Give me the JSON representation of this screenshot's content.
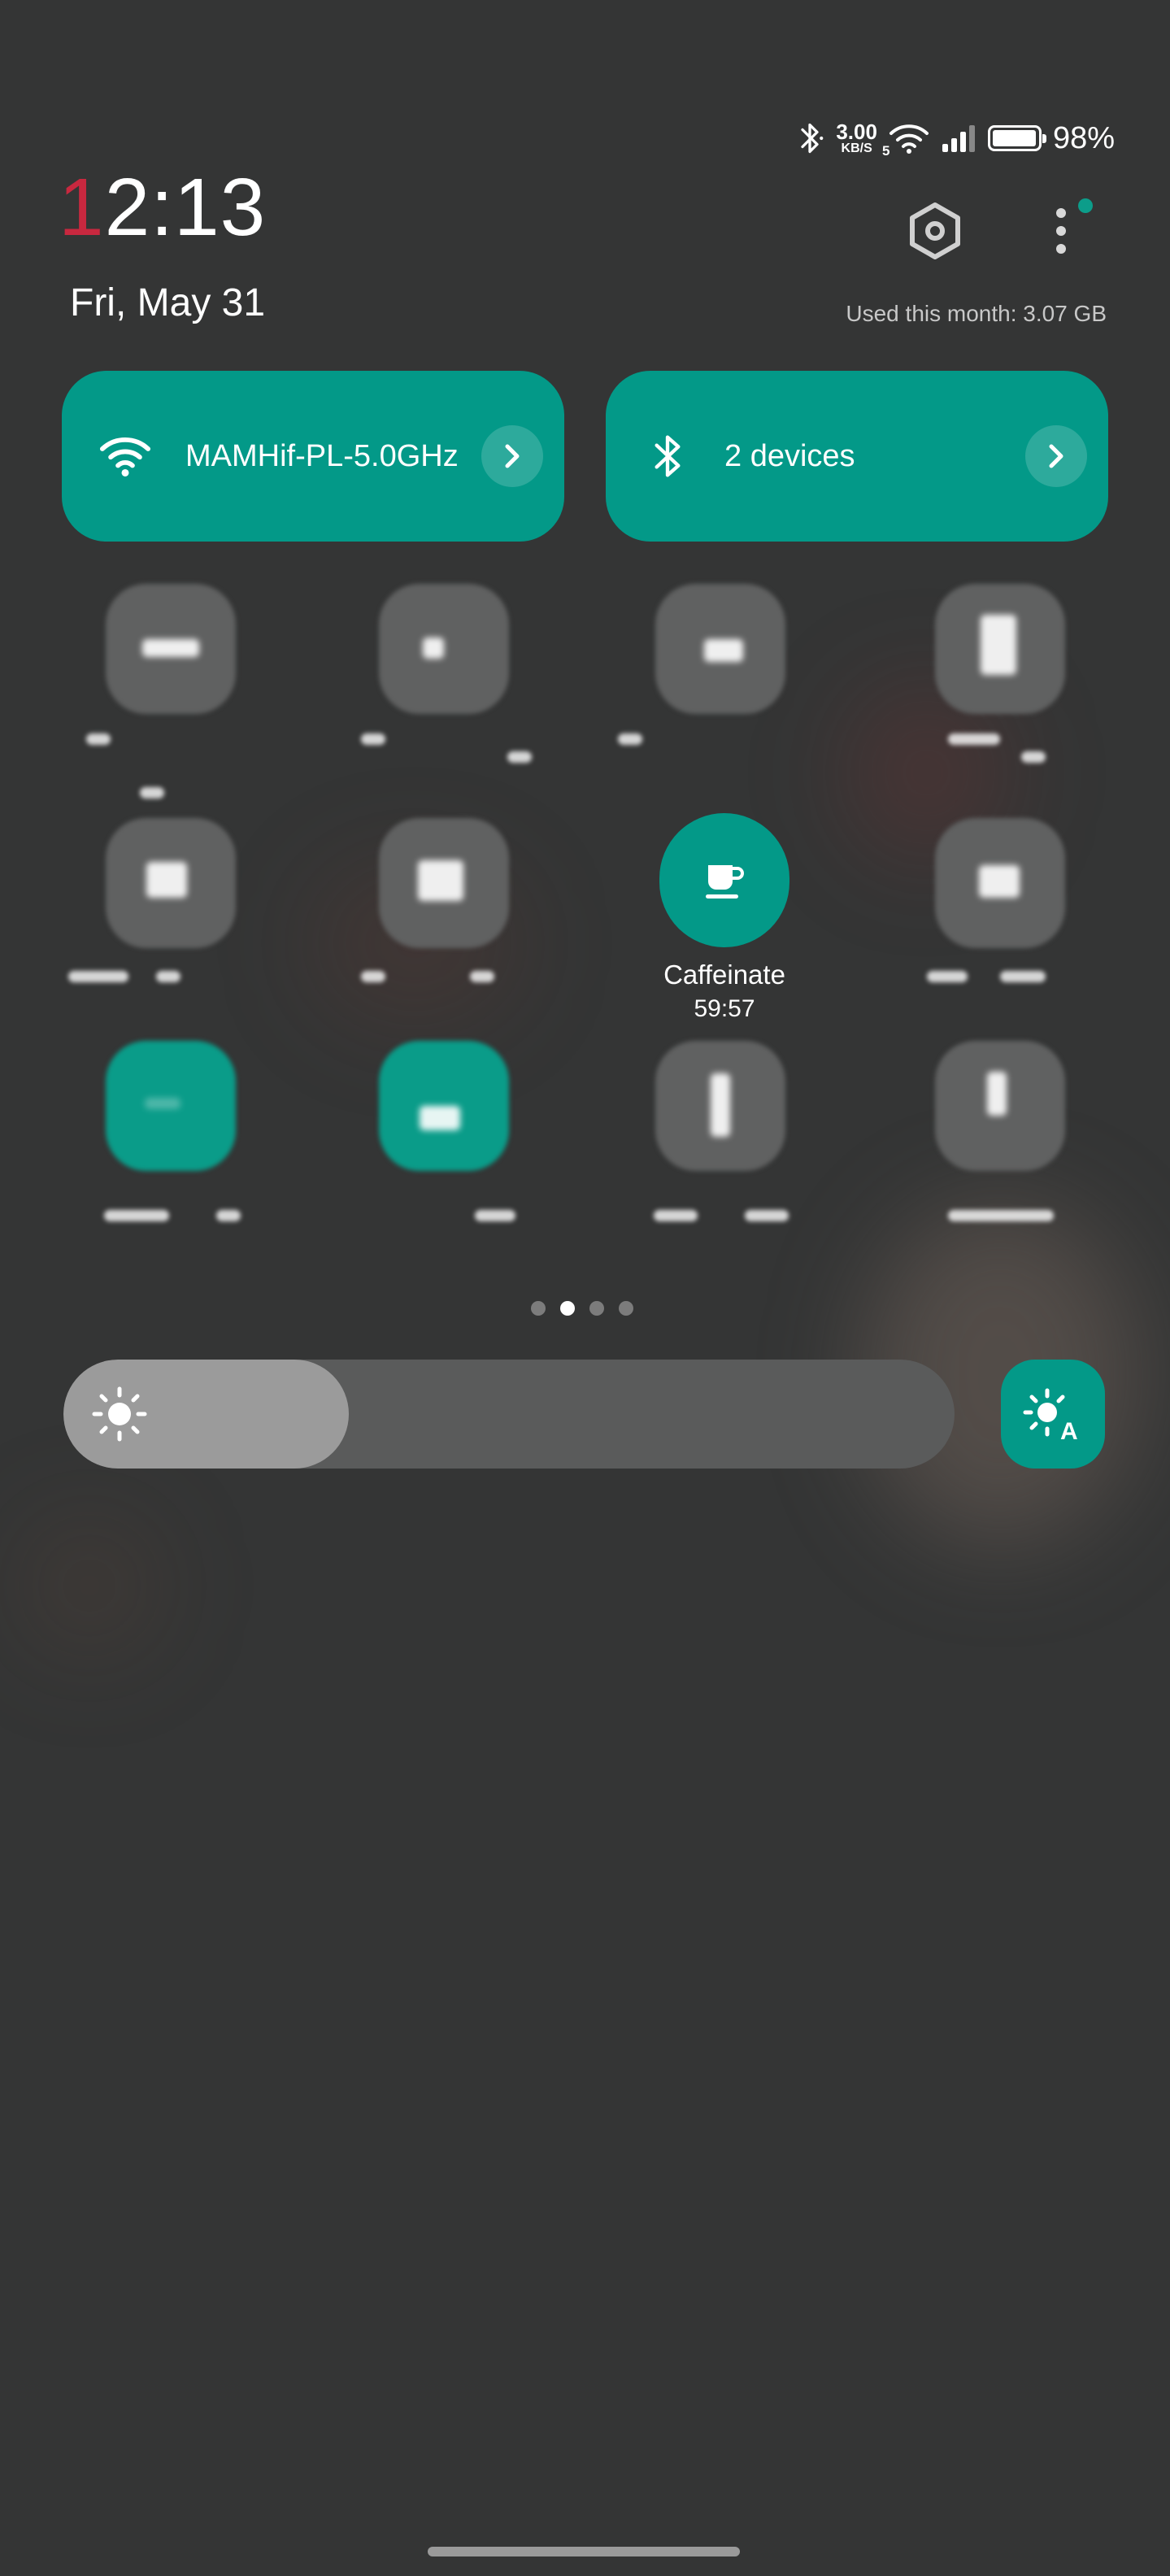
{
  "status": {
    "net_speed_value": "3.00",
    "net_speed_unit": "KB/S",
    "wifi_band": "5",
    "battery_level": 0.98,
    "battery_text": "98%",
    "icons": [
      "bluetooth-icon",
      "wifi-icon",
      "signal-icon",
      "battery-icon"
    ]
  },
  "clock": {
    "hour_first": "1",
    "rest": "2:13"
  },
  "date": "Fri, May 31",
  "data_usage": "Used this month: 3.07 GB",
  "header_icons": [
    "settings-icon",
    "more-icon"
  ],
  "wifi_tile": {
    "label": "MAMHif-PL-5.0GHz",
    "icon": "wifi-icon"
  },
  "bluetooth_tile": {
    "label": "2 devices",
    "icon": "bluetooth-icon"
  },
  "caffeinate": {
    "label": "Caffeinate",
    "time": "59:57",
    "icon": "coffee-cup-icon"
  },
  "pager": {
    "pages": 4,
    "current": 2
  },
  "brightness": {
    "level": 0.32,
    "auto_icon": "auto-brightness-icon"
  },
  "colors": {
    "accent": "#039988",
    "background": "#343535",
    "clock_red": "#c8283f"
  }
}
